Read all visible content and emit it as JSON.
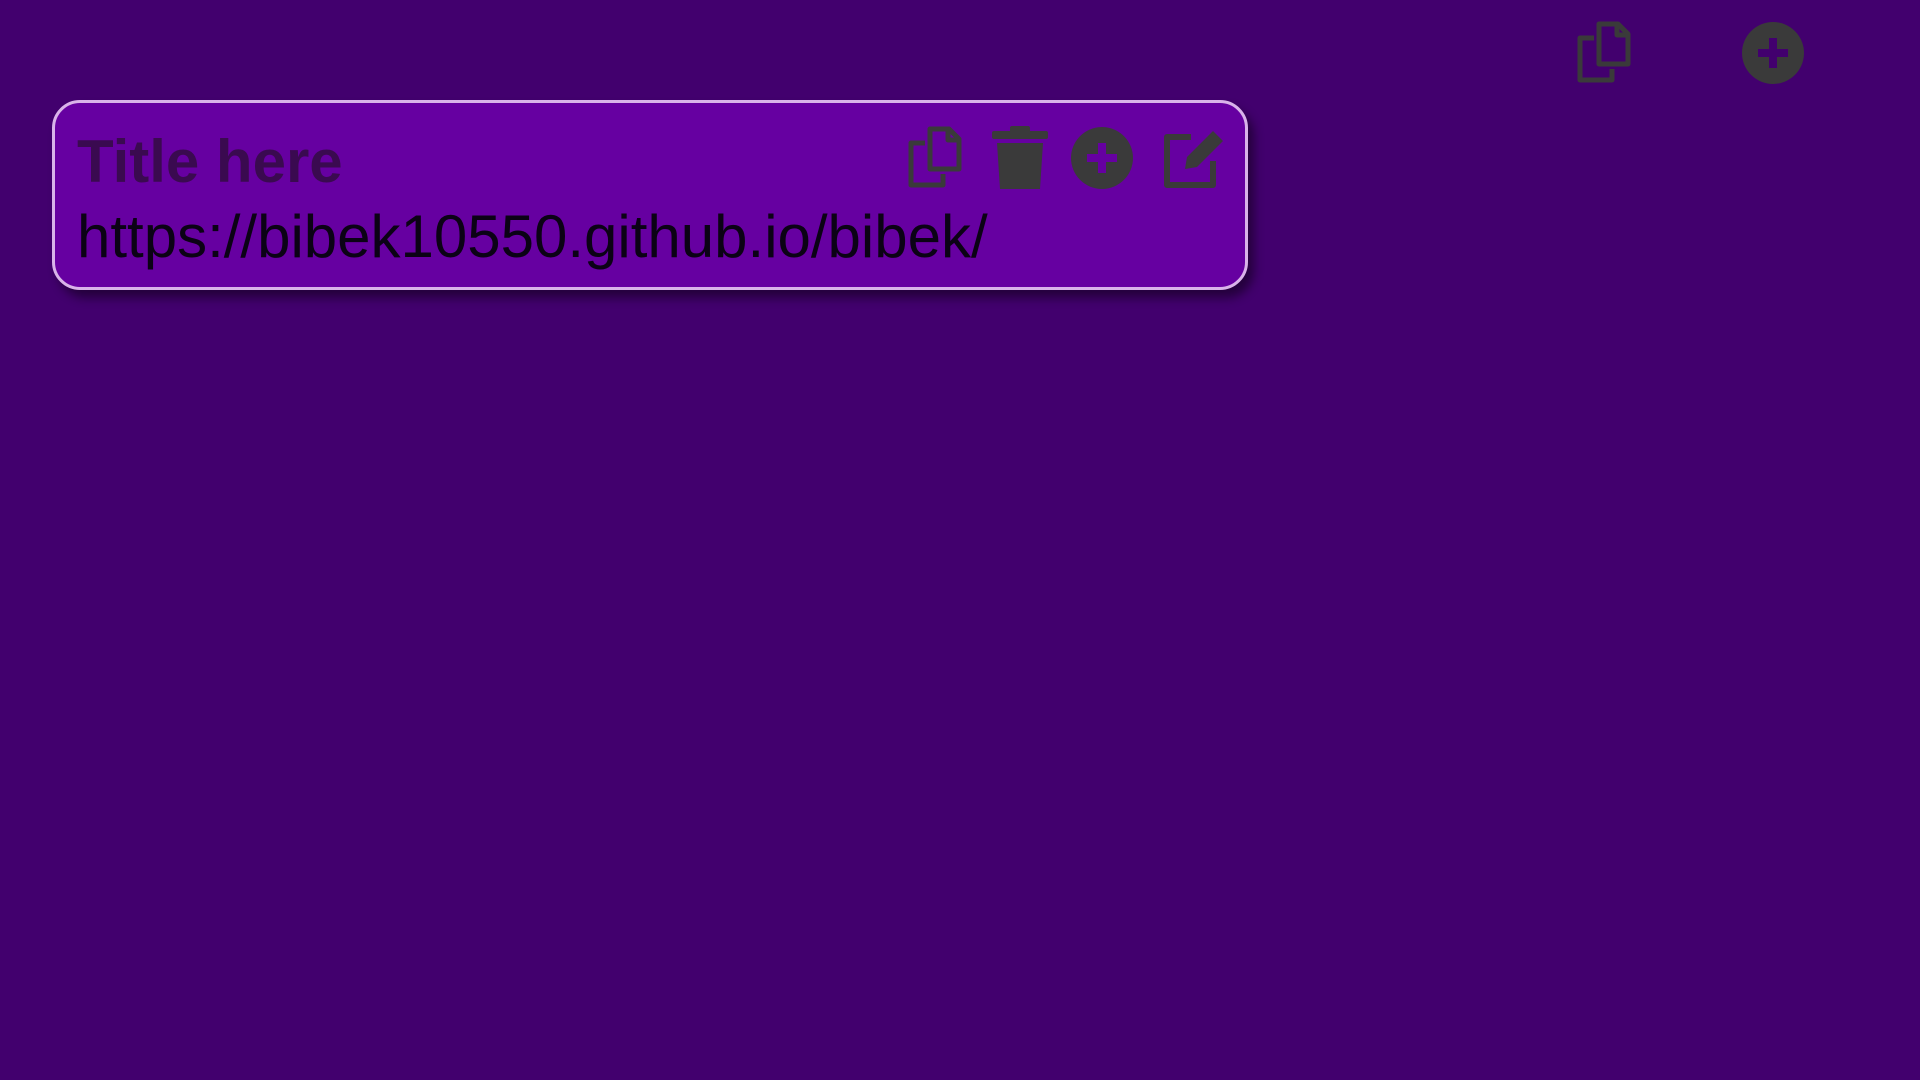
{
  "colors": {
    "background": "#42006e",
    "card_background": "#6600a1",
    "card_border": "#d9b3ea",
    "icon": "#3a3a3a",
    "title_text": "#3a0a50",
    "url_text": "#0b0215"
  },
  "toolbar": {
    "items": [
      {
        "icon": "copy-icon"
      },
      {
        "icon": "plus-circle-icon"
      }
    ]
  },
  "card": {
    "title": "Title here",
    "url": "https://bibek10550.github.io/bibek/",
    "actions": [
      {
        "icon": "copy-icon"
      },
      {
        "icon": "trash-icon"
      },
      {
        "icon": "plus-circle-icon"
      },
      {
        "icon": "edit-icon"
      }
    ]
  }
}
